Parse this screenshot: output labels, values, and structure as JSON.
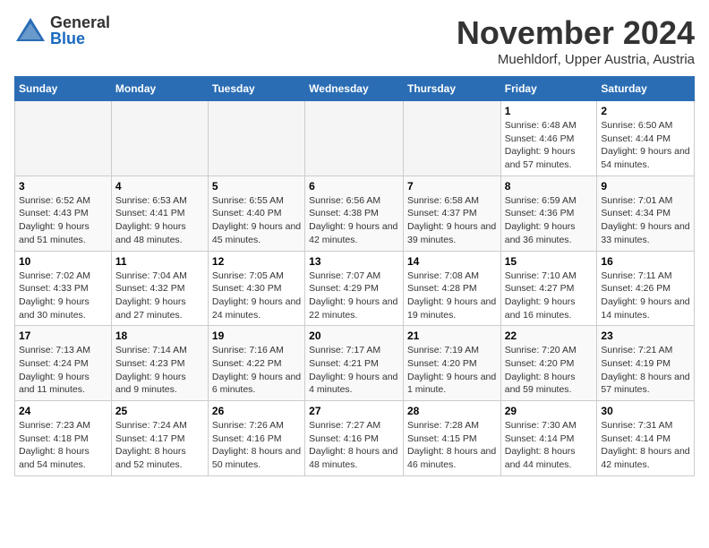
{
  "header": {
    "logo_general": "General",
    "logo_blue": "Blue",
    "month_title": "November 2024",
    "location": "Muehldorf, Upper Austria, Austria"
  },
  "weekdays": [
    "Sunday",
    "Monday",
    "Tuesday",
    "Wednesday",
    "Thursday",
    "Friday",
    "Saturday"
  ],
  "weeks": [
    [
      {
        "day": "",
        "info": ""
      },
      {
        "day": "",
        "info": ""
      },
      {
        "day": "",
        "info": ""
      },
      {
        "day": "",
        "info": ""
      },
      {
        "day": "",
        "info": ""
      },
      {
        "day": "1",
        "info": "Sunrise: 6:48 AM\nSunset: 4:46 PM\nDaylight: 9 hours and 57 minutes."
      },
      {
        "day": "2",
        "info": "Sunrise: 6:50 AM\nSunset: 4:44 PM\nDaylight: 9 hours and 54 minutes."
      }
    ],
    [
      {
        "day": "3",
        "info": "Sunrise: 6:52 AM\nSunset: 4:43 PM\nDaylight: 9 hours and 51 minutes."
      },
      {
        "day": "4",
        "info": "Sunrise: 6:53 AM\nSunset: 4:41 PM\nDaylight: 9 hours and 48 minutes."
      },
      {
        "day": "5",
        "info": "Sunrise: 6:55 AM\nSunset: 4:40 PM\nDaylight: 9 hours and 45 minutes."
      },
      {
        "day": "6",
        "info": "Sunrise: 6:56 AM\nSunset: 4:38 PM\nDaylight: 9 hours and 42 minutes."
      },
      {
        "day": "7",
        "info": "Sunrise: 6:58 AM\nSunset: 4:37 PM\nDaylight: 9 hours and 39 minutes."
      },
      {
        "day": "8",
        "info": "Sunrise: 6:59 AM\nSunset: 4:36 PM\nDaylight: 9 hours and 36 minutes."
      },
      {
        "day": "9",
        "info": "Sunrise: 7:01 AM\nSunset: 4:34 PM\nDaylight: 9 hours and 33 minutes."
      }
    ],
    [
      {
        "day": "10",
        "info": "Sunrise: 7:02 AM\nSunset: 4:33 PM\nDaylight: 9 hours and 30 minutes."
      },
      {
        "day": "11",
        "info": "Sunrise: 7:04 AM\nSunset: 4:32 PM\nDaylight: 9 hours and 27 minutes."
      },
      {
        "day": "12",
        "info": "Sunrise: 7:05 AM\nSunset: 4:30 PM\nDaylight: 9 hours and 24 minutes."
      },
      {
        "day": "13",
        "info": "Sunrise: 7:07 AM\nSunset: 4:29 PM\nDaylight: 9 hours and 22 minutes."
      },
      {
        "day": "14",
        "info": "Sunrise: 7:08 AM\nSunset: 4:28 PM\nDaylight: 9 hours and 19 minutes."
      },
      {
        "day": "15",
        "info": "Sunrise: 7:10 AM\nSunset: 4:27 PM\nDaylight: 9 hours and 16 minutes."
      },
      {
        "day": "16",
        "info": "Sunrise: 7:11 AM\nSunset: 4:26 PM\nDaylight: 9 hours and 14 minutes."
      }
    ],
    [
      {
        "day": "17",
        "info": "Sunrise: 7:13 AM\nSunset: 4:24 PM\nDaylight: 9 hours and 11 minutes."
      },
      {
        "day": "18",
        "info": "Sunrise: 7:14 AM\nSunset: 4:23 PM\nDaylight: 9 hours and 9 minutes."
      },
      {
        "day": "19",
        "info": "Sunrise: 7:16 AM\nSunset: 4:22 PM\nDaylight: 9 hours and 6 minutes."
      },
      {
        "day": "20",
        "info": "Sunrise: 7:17 AM\nSunset: 4:21 PM\nDaylight: 9 hours and 4 minutes."
      },
      {
        "day": "21",
        "info": "Sunrise: 7:19 AM\nSunset: 4:20 PM\nDaylight: 9 hours and 1 minute."
      },
      {
        "day": "22",
        "info": "Sunrise: 7:20 AM\nSunset: 4:20 PM\nDaylight: 8 hours and 59 minutes."
      },
      {
        "day": "23",
        "info": "Sunrise: 7:21 AM\nSunset: 4:19 PM\nDaylight: 8 hours and 57 minutes."
      }
    ],
    [
      {
        "day": "24",
        "info": "Sunrise: 7:23 AM\nSunset: 4:18 PM\nDaylight: 8 hours and 54 minutes."
      },
      {
        "day": "25",
        "info": "Sunrise: 7:24 AM\nSunset: 4:17 PM\nDaylight: 8 hours and 52 minutes."
      },
      {
        "day": "26",
        "info": "Sunrise: 7:26 AM\nSunset: 4:16 PM\nDaylight: 8 hours and 50 minutes."
      },
      {
        "day": "27",
        "info": "Sunrise: 7:27 AM\nSunset: 4:16 PM\nDaylight: 8 hours and 48 minutes."
      },
      {
        "day": "28",
        "info": "Sunrise: 7:28 AM\nSunset: 4:15 PM\nDaylight: 8 hours and 46 minutes."
      },
      {
        "day": "29",
        "info": "Sunrise: 7:30 AM\nSunset: 4:14 PM\nDaylight: 8 hours and 44 minutes."
      },
      {
        "day": "30",
        "info": "Sunrise: 7:31 AM\nSunset: 4:14 PM\nDaylight: 8 hours and 42 minutes."
      }
    ]
  ]
}
